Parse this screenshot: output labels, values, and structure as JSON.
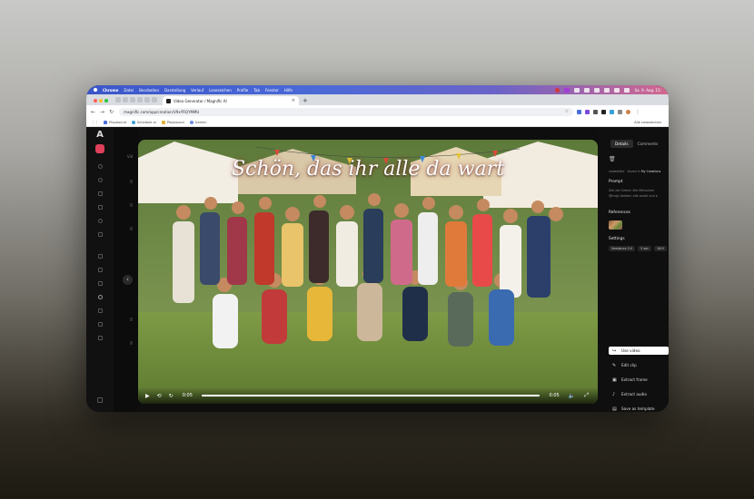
{
  "menubar": {
    "app": "Chrome",
    "items": [
      "Datei",
      "Bearbeiten",
      "Darstellung",
      "Verlauf",
      "Lesezeichen",
      "Profile",
      "Tab",
      "Fenster",
      "Hilfe"
    ],
    "clock": "Sa. 9. Aug. 15:"
  },
  "browser": {
    "tab_title": "Video Generator / Magnific AI",
    "tab_close": "×",
    "new_tab": "+",
    "url": "magnific.com/app/creation/V9xYRQYMMU",
    "bookmarks": [
      "Playbound",
      "Schedule ai",
      "Playbound",
      "Gemini"
    ],
    "bookmarks_all": "Alle Lesezeichen"
  },
  "sidebar": {
    "logo": "A",
    "column_label": "Vid",
    "collapse_arrow": "‹"
  },
  "video": {
    "caption": "Schön, das ihr alle da wart",
    "current_time": "0:05",
    "duration": "0:05",
    "progress": 1.0
  },
  "panel": {
    "tabs": [
      "Details",
      "Comments"
    ],
    "active_tab": "Details",
    "meta_user": "vladerblitz",
    "meta_label": "Saved in",
    "meta_folder": "My Creations",
    "prompt_title": "Prompt",
    "prompt_lines": [
      "Ziel der Szene: Die Menschen",
      "@img1 bleiben alle exakt und e"
    ],
    "references_title": "References",
    "settings_title": "Settings",
    "settings_chips": [
      "Seedance 2.0",
      "5 sec",
      "16:9"
    ],
    "actions": [
      {
        "label": "Use video",
        "icon": "↪"
      },
      {
        "label": "Edit clip",
        "icon": "✎"
      },
      {
        "label": "Extract frame",
        "icon": "▣"
      },
      {
        "label": "Extract audio",
        "icon": "♪"
      },
      {
        "label": "Save as template",
        "icon": "▤"
      }
    ]
  },
  "colors": {
    "accent_red": "#e0405a",
    "menubar_blue": "#3b56c9"
  }
}
